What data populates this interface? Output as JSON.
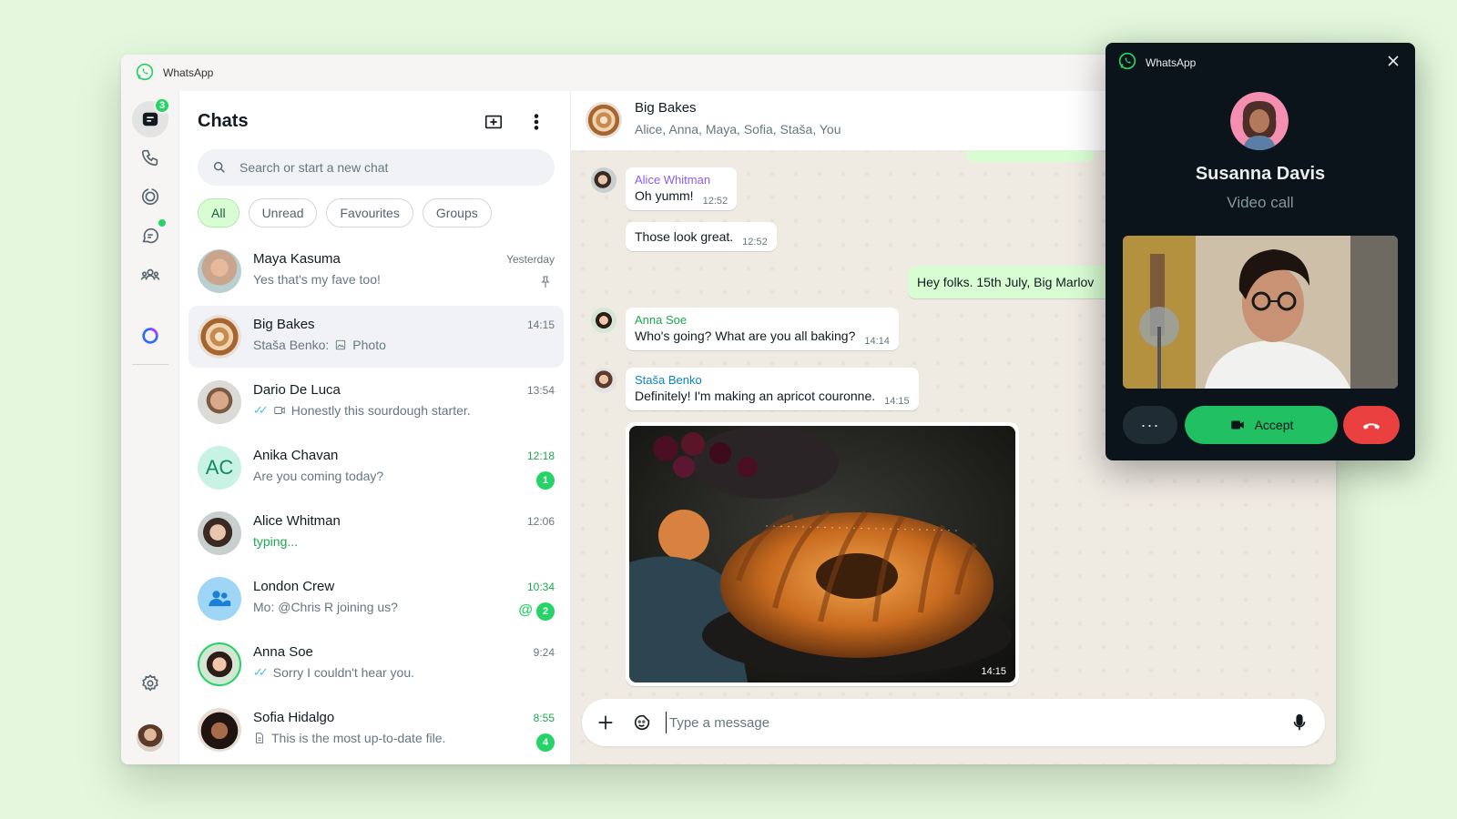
{
  "app": {
    "title": "WhatsApp"
  },
  "rail": {
    "chats_badge": "3"
  },
  "chat_list": {
    "title": "Chats",
    "search": {
      "placeholder": "Search or start a new chat"
    },
    "filters": [
      "All",
      "Unread",
      "Favourites",
      "Groups"
    ],
    "chats": [
      {
        "name": "Maya Kasuma",
        "time": "Yesterday",
        "preview": "Yes that's my fave too!",
        "pinned": true
      },
      {
        "name": "Big Bakes",
        "time": "14:15",
        "preview_sender": "Staša Benko:",
        "preview": "Photo"
      },
      {
        "name": "Dario De Luca",
        "time": "13:54",
        "preview": "Honestly this sourdough starter."
      },
      {
        "name": "Anika Chavan",
        "initials": "AC",
        "time": "12:18",
        "preview": "Are you coming today?",
        "unread": "1"
      },
      {
        "name": "Alice Whitman",
        "time": "12:06",
        "preview": "typing..."
      },
      {
        "name": "London Crew",
        "time": "10:34",
        "preview": "Mo: @Chris R joining us?",
        "mention": "@",
        "unread": "2"
      },
      {
        "name": "Anna Soe",
        "time": "9:24",
        "preview": "Sorry I couldn't hear you."
      },
      {
        "name": "Sofia Hidalgo",
        "time": "8:55",
        "preview": "This is the most up-to-date file.",
        "unread": "4"
      }
    ]
  },
  "conversation": {
    "name": "Big Bakes",
    "members": "Alice, Anna, Maya, Sofia, Staša, You",
    "messages": [
      {
        "sender": "Alice Whitman",
        "sender_color": "#8b5cf6",
        "text": "Oh yumm!",
        "time": "12:52"
      },
      {
        "text": "Those look great.",
        "time": "12:52"
      },
      {
        "text": "Hey folks. 15th July, Big Marlov",
        "outgoing": true
      },
      {
        "sender": "Anna Soe",
        "sender_color": "#1da851",
        "text": "Who's going? What are you all baking?",
        "time": "14:14"
      },
      {
        "sender": "Staša Benko",
        "sender_color": "#0a84c9",
        "text": "Definitely! I'm making an apricot couronne.",
        "time": "14:15"
      }
    ],
    "photo_time": "14:15",
    "composer": {
      "placeholder": "Type a message"
    }
  },
  "call": {
    "app_title": "WhatsApp",
    "caller": "Susanna Davis",
    "type": "Video call",
    "more": "···",
    "accept": "Accept"
  },
  "colors": {
    "accent": "#25d366",
    "decline": "#ea4040",
    "outgoing_bubble": "#d9fdd3"
  }
}
